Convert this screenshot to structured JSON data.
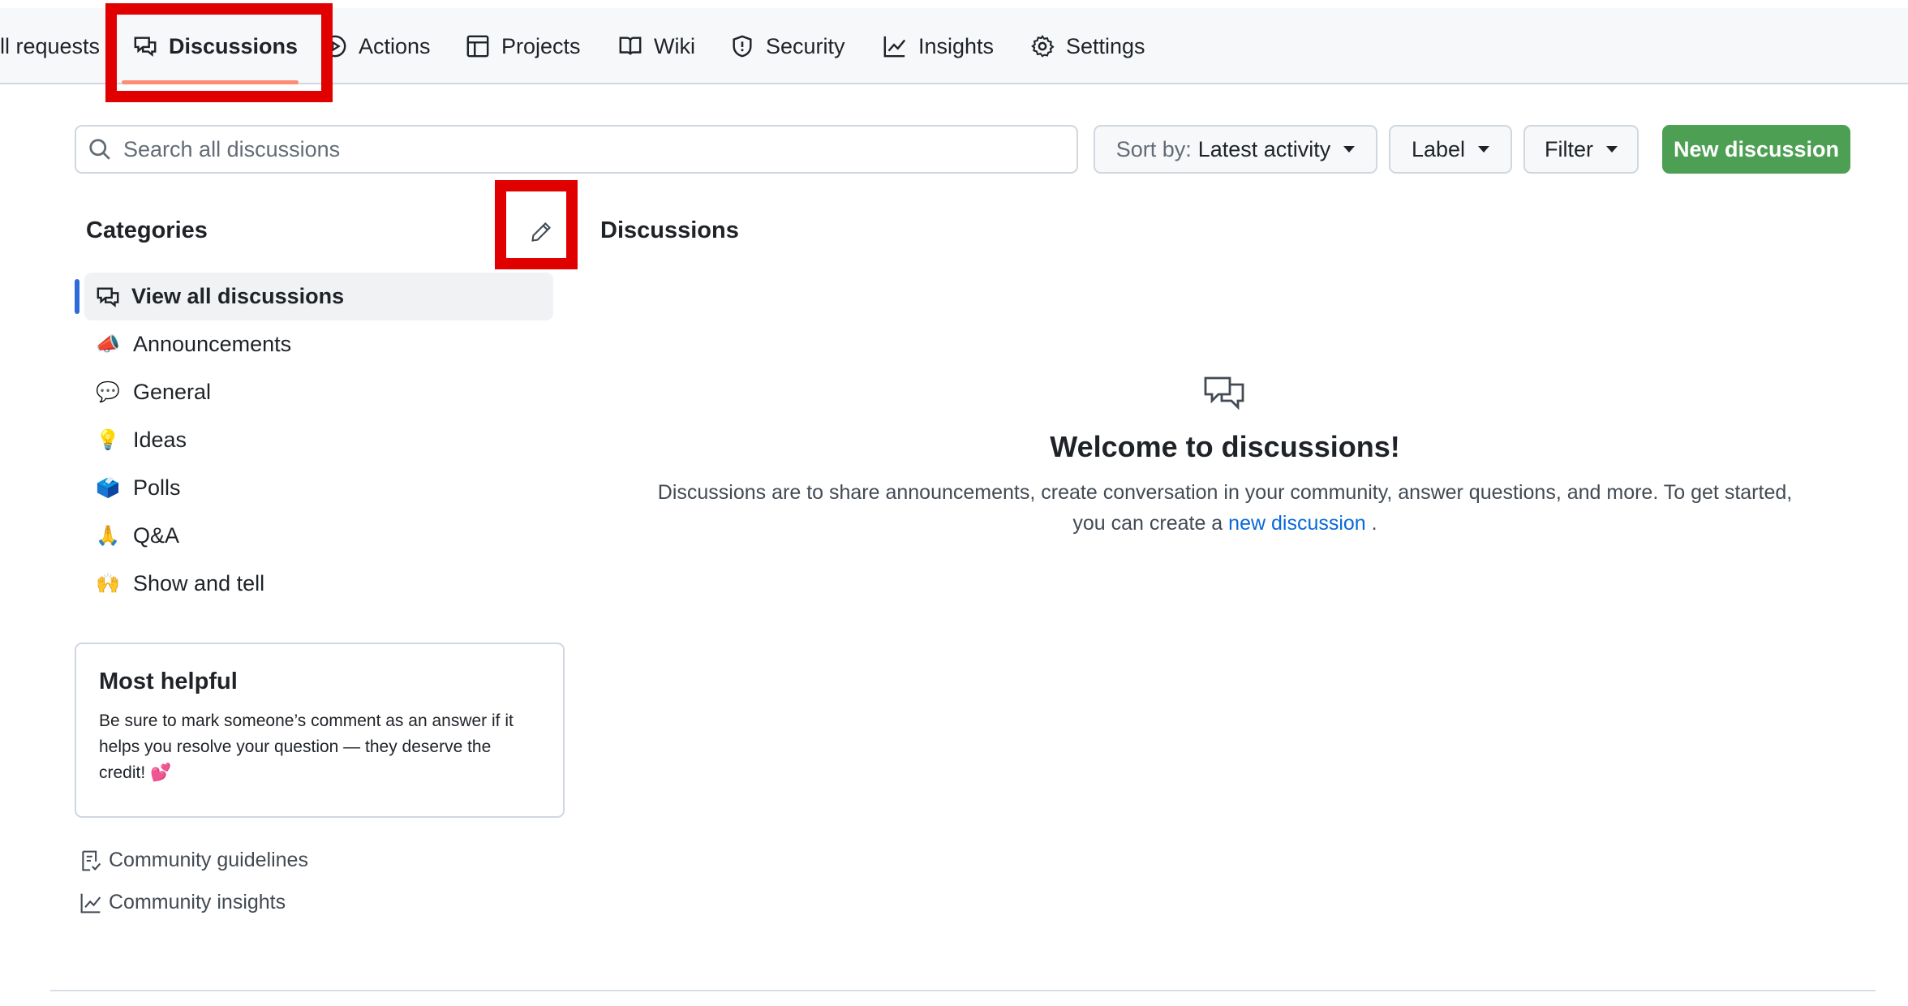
{
  "nav": {
    "tabs": [
      {
        "label": "ll requests",
        "icon": "pull-request-icon"
      },
      {
        "label": "Discussions",
        "icon": "comment-discussion-icon",
        "active": true
      },
      {
        "label": "Actions",
        "icon": "play-icon"
      },
      {
        "label": "Projects",
        "icon": "table-icon"
      },
      {
        "label": "Wiki",
        "icon": "book-icon"
      },
      {
        "label": "Security",
        "icon": "shield-icon"
      },
      {
        "label": "Insights",
        "icon": "graph-icon"
      },
      {
        "label": "Settings",
        "icon": "gear-icon"
      }
    ]
  },
  "toolbar": {
    "search_placeholder": "Search all discussions",
    "sort_prefix": "Sort by:",
    "sort_value": "Latest activity",
    "label_button": "Label",
    "filter_button": "Filter",
    "new_button": "New discussion"
  },
  "sidebar": {
    "title": "Categories",
    "items": [
      {
        "label": "View all discussions",
        "icon": "comment-discussion-icon",
        "selected": true
      },
      {
        "label": "Announcements",
        "emoji": "📣"
      },
      {
        "label": "General",
        "emoji": "💬"
      },
      {
        "label": "Ideas",
        "emoji": "💡"
      },
      {
        "label": "Polls",
        "emoji": "🗳️"
      },
      {
        "label": "Q&A",
        "emoji": "🙏"
      },
      {
        "label": "Show and tell",
        "emoji": "🙌"
      }
    ],
    "helpful": {
      "title": "Most helpful",
      "text": "Be sure to mark someone’s comment as an answer if it helps you resolve your question — they deserve the credit! 💕"
    },
    "links": {
      "guidelines": "Community guidelines",
      "insights": "Community insights"
    }
  },
  "main": {
    "title": "Discussions",
    "welcome": "Welcome to discussions!",
    "desc_before": "Discussions are to share announcements, create conversation in your community, answer questions, and more. To get started, you can create a",
    "desc_link": "new discussion",
    "desc_after": "."
  },
  "colors": {
    "accent_green": "#4c9f53",
    "link_blue": "#0969da",
    "active_underline": "#fd8c73",
    "highlight_red": "#e00000"
  }
}
